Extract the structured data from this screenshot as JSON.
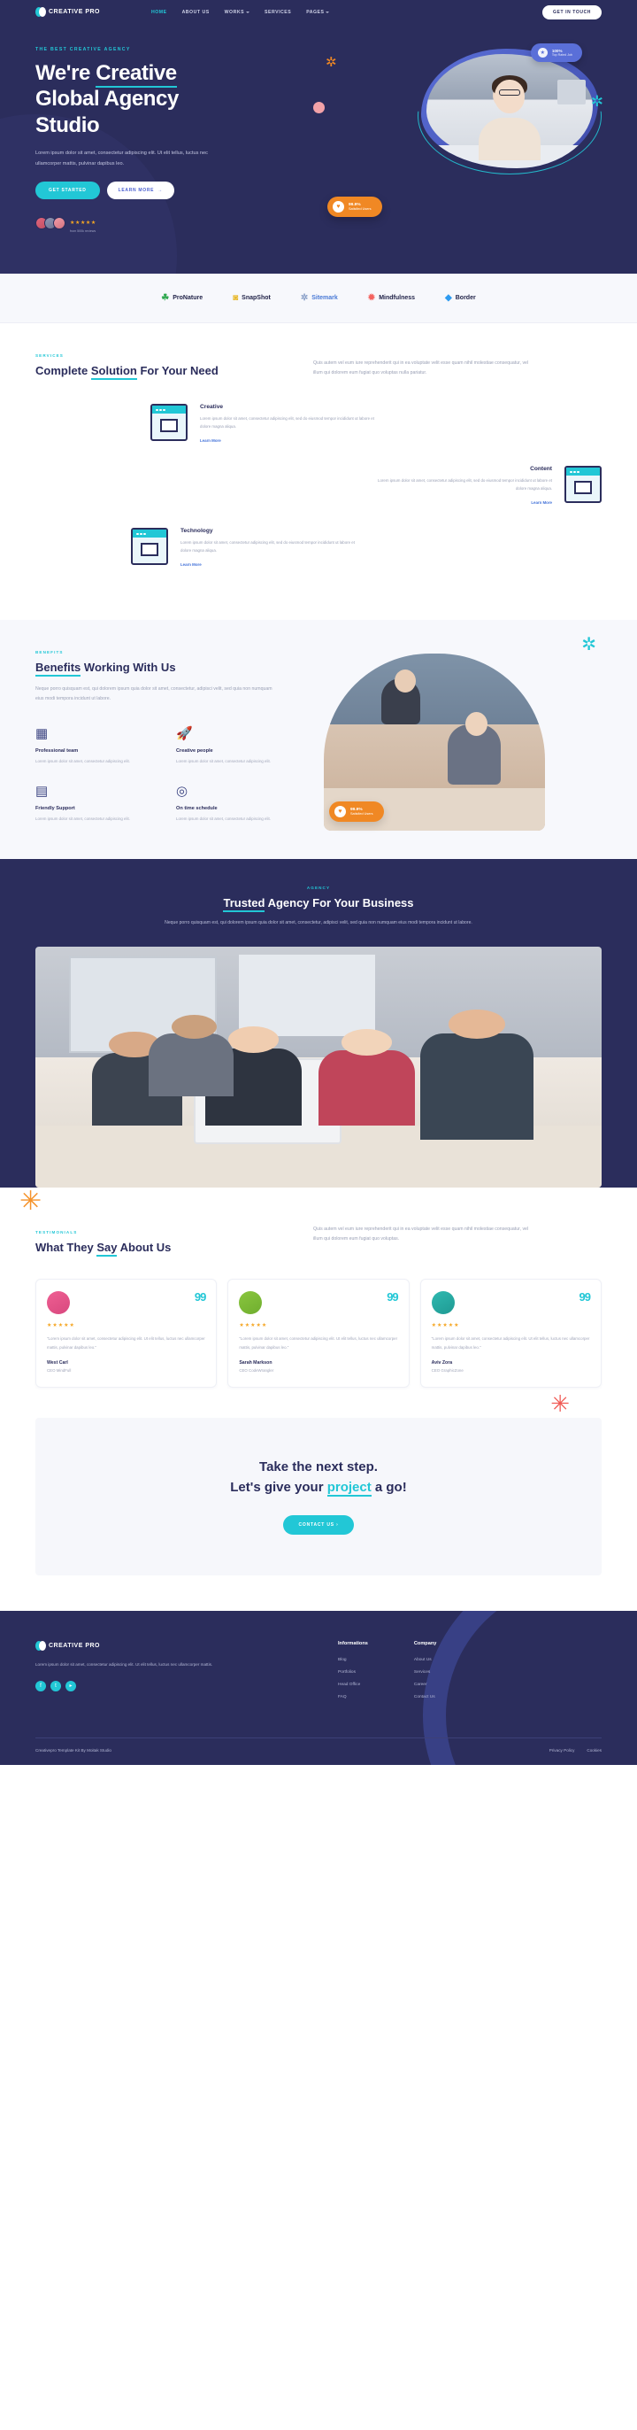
{
  "nav": {
    "brand": "CREATIVE PRO",
    "links": [
      {
        "label": "HOME",
        "active": true,
        "caret": false
      },
      {
        "label": "ABOUT US",
        "active": false,
        "caret": false
      },
      {
        "label": "WORKS",
        "active": false,
        "caret": true
      },
      {
        "label": "SERVICES",
        "active": false,
        "caret": false
      },
      {
        "label": "PAGES",
        "active": false,
        "caret": true
      }
    ],
    "cta": "GET IN TOUCH"
  },
  "hero": {
    "eyebrow": "THE BEST CREATIVE AGENCY",
    "title_line1_a": "We're ",
    "title_line1_b": "Creative",
    "title_line2": "Global Agency",
    "title_line3": "Studio",
    "paragraph": "Lorem ipsum dolor sit amet, consectetur adipiscing elit. Ut elit tellus, luctus nec ullamcorper mattis, pulvinar dapibus leo.",
    "btn_primary": "GET STARTED",
    "btn_secondary": "LEARN MORE",
    "stars": "★★★★★",
    "rating_sub": "from 500k reviews",
    "badge_top_value": "100%",
    "badge_top_label": "Top Rated Job",
    "badge_orange_value": "99.9%",
    "badge_orange_label": "Satisfied Users"
  },
  "brands": [
    {
      "name": "ProNature",
      "icon": "☘",
      "icon_color": "#2fa84f",
      "text_color": "#1f2147"
    },
    {
      "name": "SnapShot",
      "icon": "◙",
      "icon_color": "#e8b92e",
      "text_color": "#1f2147"
    },
    {
      "name": "Sitemark",
      "icon": "✲",
      "icon_color": "#8aa0c8",
      "text_color": "#4a7ad6"
    },
    {
      "name": "Mindfulness",
      "icon": "✹",
      "icon_color": "#f4625e",
      "text_color": "#1f2147"
    },
    {
      "name": "Border",
      "icon": "◆",
      "icon_color": "#2e9bf0",
      "text_color": "#1f2147"
    }
  ],
  "services": {
    "label": "SERVICES",
    "title_a": "Complete ",
    "title_b": "Solution",
    "title_c": " For Your Need",
    "lead": "Quis autem vel eum iure reprehenderit qui in ea voluptate velit esse quam nihil molestiae consequatur, vel illum qui dolorem eum fugiat quo voluptas nulla pariatur.",
    "items": [
      {
        "title": "Creative",
        "text": "Lorem ipsum dolor sit amet, consectetur adipiscing elit, sed do eiusmod tempor incididunt ut labore et dolore magna aliqua.",
        "link": "Learn More"
      },
      {
        "title": "Content",
        "text": "Lorem ipsum dolor sit amet, consectetur adipiscing elit, sed do eiusmod tempor incididunt ut labore et dolore magna aliqua.",
        "link": "Learn More"
      },
      {
        "title": "Technology",
        "text": "Lorem ipsum dolor sit amet, consectetur adipiscing elit, sed do eiusmod tempor incididunt ut labore et dolore magna aliqua.",
        "link": "Learn More"
      }
    ]
  },
  "benefits": {
    "label": "BENEFITS",
    "title_a": "Benefits",
    "title_b": " Working With Us",
    "lead": "Neque porro quisquam est, qui dolorem ipsum quia dolor sit amet, consectetur, adipisci velit, sed quia non numquam eius modi tempora incidunt ut labore.",
    "items": [
      {
        "icon": "▦",
        "title": "Professional team",
        "text": "Lorem ipsum dolor sit amet, consectetur adipiscing elit."
      },
      {
        "icon": "🚀",
        "title": "Creative people",
        "text": "Lorem ipsum dolor sit amet, consectetur adipiscing elit."
      },
      {
        "icon": "▤",
        "title": "Friendly Support",
        "text": "Lorem ipsum dolor sit amet, consectetur adipiscing elit."
      },
      {
        "icon": "◎",
        "title": "On time schedule",
        "text": "Lorem ipsum dolor sit amet, consectetur adipiscing elit."
      }
    ],
    "badge_value": "99.9%",
    "badge_label": "Satisfied Users"
  },
  "agency": {
    "label": "AGENCY",
    "title_a": "Trusted",
    "title_b": " Agency For Your Business",
    "lead": "Neque porro quisquam est, qui dolorem ipsum quia dolor sit amet, consectetur, adipisci velit, sed quia non numquam eius modi tempora incidunt ut labore."
  },
  "testimonials": {
    "label": "TESTIMONIALS",
    "title_a": "What They ",
    "title_b": "Say",
    "title_c": " About Us",
    "lead": "Quis autem vel eum iure reprehenderit qui in ea voluptate velit esse quam nihil molestiae consequatur, vel illum qui dolorem eum fugiat quo voluptas.",
    "quote_mark": "99",
    "stars": "★★★★★",
    "cards": [
      {
        "text": "\"Lorem ipsum dolor sit amet, consectetur adipiscing elit. Ut elit tellus, luctus nec ullamcorper mattis, pulvinar dapibus leo.\"",
        "name": "West Carl",
        "role": "CEO MindFull"
      },
      {
        "text": "\"Lorem ipsum dolor sit amet, consectetur adipiscing elit. Ut elit tellus, luctus nec ullamcorper mattis, pulvinar dapibus leo.\"",
        "name": "Sarah Markson",
        "role": "CEO CodeWrangler"
      },
      {
        "text": "\"Lorem ipsum dolor sit amet, consectetur adipiscing elit. Ut elit tellus, luctus nec ullamcorper mattis, pulvinar dapibus leo.\"",
        "name": "Aviv Zora",
        "role": "CEO GraphicZone"
      }
    ]
  },
  "cta": {
    "line1": "Take the next step.",
    "line2_a": "Let's give your ",
    "line2_b": "project",
    "line2_c": " a go!",
    "button": "CONTACT US"
  },
  "footer": {
    "brand": "CREATIVE PRO",
    "about": "Lorem ipsum dolor sit amet, consectetur adipiscing elit. Ut elit tellus, luctus nec ullamcorper mattis.",
    "socials": [
      "f",
      "t",
      "▸"
    ],
    "columns": [
      {
        "heading": "Informations",
        "links": [
          "Blog",
          "Portfolios",
          "Head Office",
          "FAQ"
        ]
      },
      {
        "heading": "Company",
        "links": [
          "About Us",
          "Services",
          "Career",
          "Contact Us"
        ]
      }
    ],
    "copyright": "Creativepro Template Kit By Moitak Studio",
    "bottom_links": [
      "Privacy Policy",
      "Cookies"
    ]
  },
  "colors": {
    "navy": "#2b2d5c",
    "cyan": "#22c7d6",
    "orange": "#f08824",
    "blue": "#5a6fd8",
    "red": "#f05a55",
    "amber": "#f5a623"
  }
}
